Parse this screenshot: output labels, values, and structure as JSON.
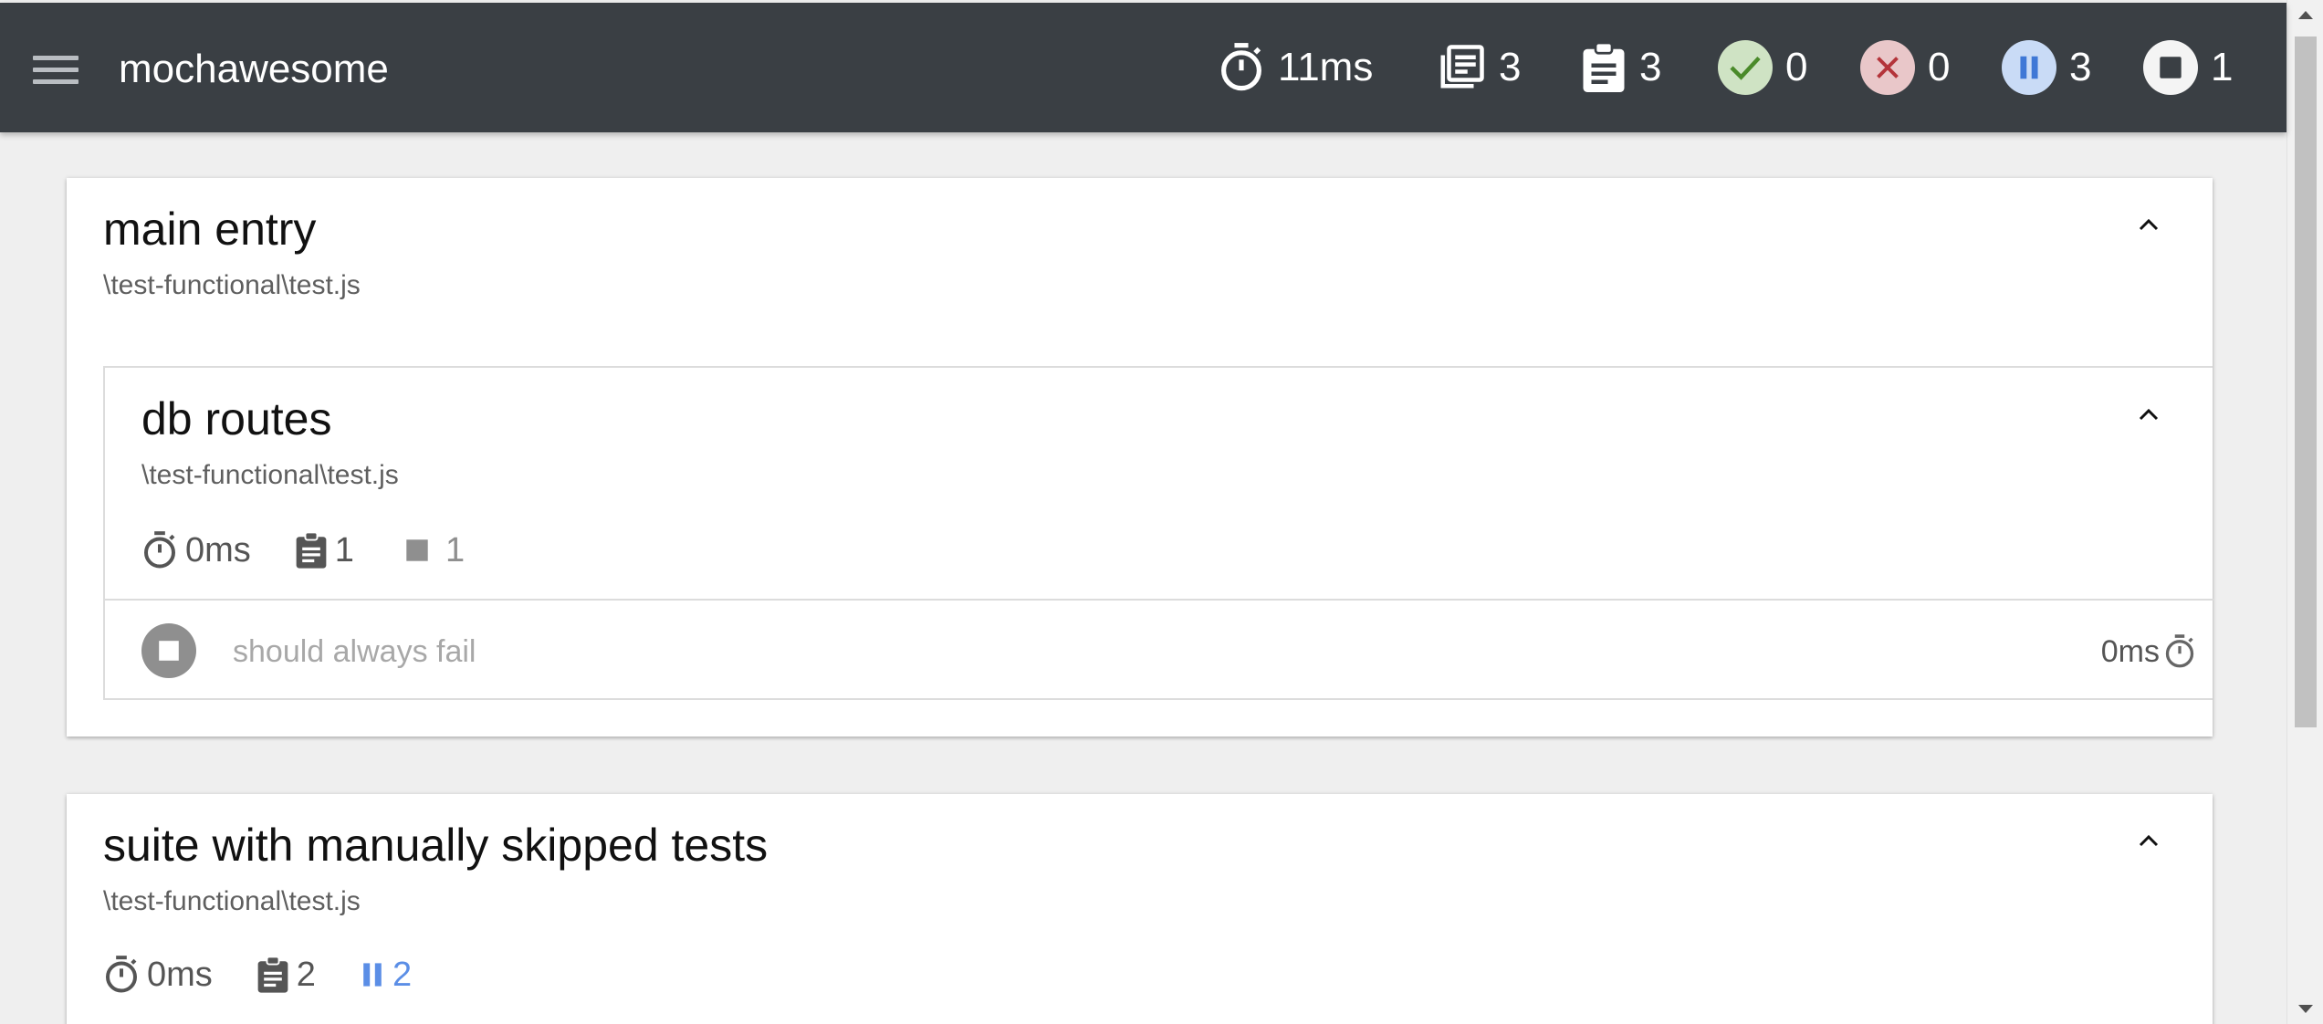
{
  "app": {
    "brand": "mochawesome"
  },
  "nav_stats": {
    "duration": "11ms",
    "suites": "3",
    "tests": "3",
    "passed": "0",
    "failed": "0",
    "pending": "3",
    "skipped": "1"
  },
  "colors": {
    "navbar_bg": "#3a3f44",
    "passed_bg": "#cfe3c4",
    "passed_fg": "#4a8a2a",
    "failed_bg": "#e9c7c9",
    "failed_fg": "#b4343a",
    "pending_bg": "#c9dbf6",
    "pending_fg": "#3f78d6",
    "skipped_bg": "#f4f4f4",
    "skipped_fg": "#3a3f44"
  },
  "icons": {
    "menu": "hamburger-icon",
    "duration": "stopwatch-icon",
    "suites": "library-books-icon",
    "tests": "assignment-icon",
    "passed": "check-icon",
    "failed": "close-icon",
    "pending": "pause-icon",
    "skipped": "stop-icon",
    "collapse": "chevron-up-icon"
  },
  "suites": [
    {
      "title": "main entry",
      "file": "\\test-functional\\test.js",
      "children": [
        {
          "title": "db routes",
          "file": "\\test-functional\\test.js",
          "meta": {
            "duration": "0ms",
            "tests": "1",
            "skipped": "1"
          },
          "tests": [
            {
              "title": "should always fail",
              "duration": "0ms",
              "state": "skipped"
            }
          ]
        }
      ]
    },
    {
      "title": "suite with manually skipped tests",
      "file": "\\test-functional\\test.js",
      "meta": {
        "duration": "0ms",
        "tests": "2",
        "pending": "2"
      }
    }
  ]
}
